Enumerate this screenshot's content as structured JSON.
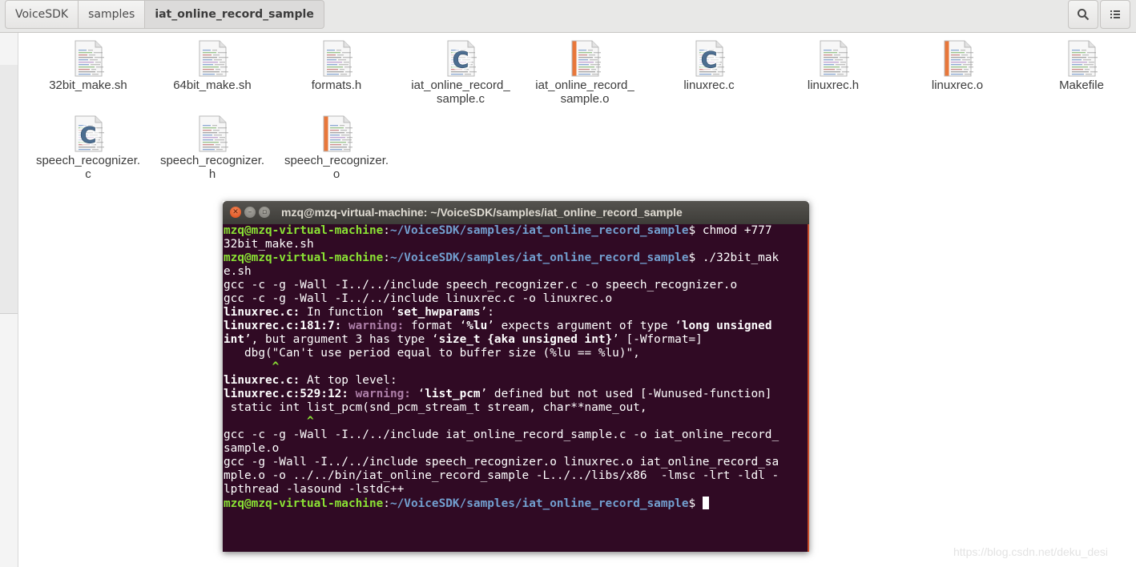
{
  "breadcrumbs": [
    "VoiceSDK",
    "samples",
    "iat_online_record_sample"
  ],
  "header_icons": [
    "search-icon",
    "list-view-icon"
  ],
  "files": [
    {
      "name": "32bit_make.sh",
      "icon": "text-file-icon"
    },
    {
      "name": "64bit_make.sh",
      "icon": "text-file-icon"
    },
    {
      "name": "formats.h",
      "icon": "text-file-icon"
    },
    {
      "name": "iat_online_record_\nsample.c",
      "icon": "c-source-icon"
    },
    {
      "name": "iat_online_record_\nsample.o",
      "icon": "object-file-icon"
    },
    {
      "name": "linuxrec.c",
      "icon": "c-source-icon"
    },
    {
      "name": "linuxrec.h",
      "icon": "text-file-icon"
    },
    {
      "name": "linuxrec.o",
      "icon": "object-file-icon"
    },
    {
      "name": "Makefile",
      "icon": "text-file-icon"
    },
    {
      "name": "speech_recognizer.\nc",
      "icon": "c-source-icon"
    },
    {
      "name": "speech_recognizer.\nh",
      "icon": "text-file-icon"
    },
    {
      "name": "speech_recognizer.\no",
      "icon": "object-file-icon"
    }
  ],
  "terminal": {
    "title": "mzq@mzq-virtual-machine: ~/VoiceSDK/samples/iat_online_record_sample",
    "user_host": "mzq@mzq-virtual-machine",
    "path": "~/VoiceSDK/samples/iat_online_record_sample",
    "lines": [
      [
        {
          "t": "mzq@mzq-virtual-machine",
          "c": "pg"
        },
        {
          "t": ":"
        },
        {
          "t": "~/VoiceSDK/samples/iat_online_record_sample",
          "c": "pb"
        },
        {
          "t": "$ chmod +777 "
        }
      ],
      [
        {
          "t": "32bit_make.sh"
        }
      ],
      [
        {
          "t": "mzq@mzq-virtual-machine",
          "c": "pg"
        },
        {
          "t": ":"
        },
        {
          "t": "~/VoiceSDK/samples/iat_online_record_sample",
          "c": "pb"
        },
        {
          "t": "$ ./32bit_mak"
        }
      ],
      [
        {
          "t": "e.sh"
        }
      ],
      [
        {
          "t": "gcc -c -g -Wall -I../../include speech_recognizer.c -o speech_recognizer.o"
        }
      ],
      [
        {
          "t": "gcc -c -g -Wall -I../../include linuxrec.c -o linuxrec.o"
        }
      ],
      [
        {
          "t": "linuxrec.c:",
          "c": "b"
        },
        {
          "t": " In function ‘"
        },
        {
          "t": "set_hwparams",
          "c": "b"
        },
        {
          "t": "’:"
        }
      ],
      [
        {
          "t": "linuxrec.c:181:7:",
          "c": "b"
        },
        {
          "t": " "
        },
        {
          "t": "warning:",
          "c": "w"
        },
        {
          "t": " format ‘"
        },
        {
          "t": "%lu",
          "c": "b"
        },
        {
          "t": "’ expects argument of type ‘"
        },
        {
          "t": "long unsigned",
          "c": "b"
        }
      ],
      [
        {
          "t": "int",
          "c": "b"
        },
        {
          "t": "’, but argument 3 has type ‘"
        },
        {
          "t": "size_t {aka unsigned int}",
          "c": "b"
        },
        {
          "t": "’ [-Wformat=]"
        }
      ],
      [
        {
          "t": "   dbg(\"Can't use period equal to buffer size (%lu == %lu)\","
        }
      ],
      [
        {
          "t": "       "
        },
        {
          "t": "^",
          "c": "car"
        }
      ],
      [
        {
          "t": "linuxrec.c:",
          "c": "b"
        },
        {
          "t": " At top level:"
        }
      ],
      [
        {
          "t": "linuxrec.c:529:12:",
          "c": "b"
        },
        {
          "t": " "
        },
        {
          "t": "warning:",
          "c": "w"
        },
        {
          "t": " ‘"
        },
        {
          "t": "list_pcm",
          "c": "b"
        },
        {
          "t": "’ defined but not used [-Wunused-function]"
        }
      ],
      [
        {
          "t": " static int list_pcm(snd_pcm_stream_t stream, char**name_out,"
        }
      ],
      [
        {
          "t": "            "
        },
        {
          "t": "^",
          "c": "car"
        }
      ],
      [
        {
          "t": "gcc -c -g -Wall -I../../include iat_online_record_sample.c -o iat_online_record_"
        }
      ],
      [
        {
          "t": "sample.o"
        }
      ],
      [
        {
          "t": "gcc -g -Wall -I../../include speech_recognizer.o linuxrec.o iat_online_record_sa"
        }
      ],
      [
        {
          "t": "mple.o -o ../../bin/iat_online_record_sample -L../../libs/x86  -lmsc -lrt -ldl -"
        }
      ],
      [
        {
          "t": "lpthread -lasound -lstdc++"
        }
      ],
      [
        {
          "t": "mzq@mzq-virtual-machine",
          "c": "pg"
        },
        {
          "t": ":"
        },
        {
          "t": "~/VoiceSDK/samples/iat_online_record_sample",
          "c": "pb"
        },
        {
          "t": "$ "
        }
      ]
    ]
  },
  "watermark": "https://blog.csdn.net/deku_desi",
  "colors": {
    "terminal_bg": "#300a24",
    "prompt_user": "#8ae234",
    "prompt_path": "#729fcf",
    "warning": "#ad7fa8",
    "titlebar": "#3d3c38"
  }
}
